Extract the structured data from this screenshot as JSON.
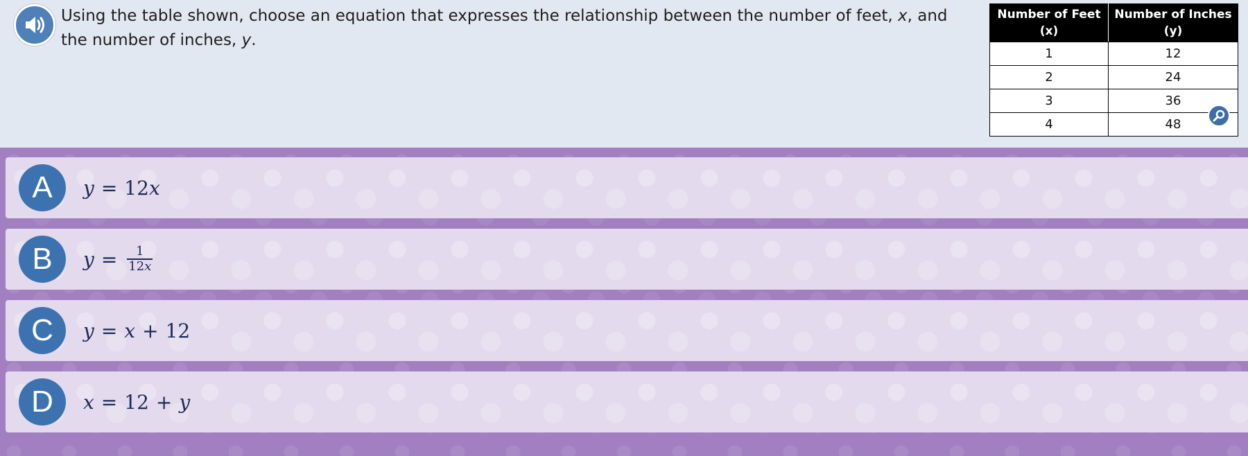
{
  "question": {
    "text_before_x": "Using the table shown, choose an equation that expresses the relationship between the number of feet, ",
    "var_x": "x",
    "text_between": ", and the number of inches, ",
    "var_y": "y",
    "text_end": "."
  },
  "table": {
    "headers": [
      {
        "line1": "Number of Feet",
        "line2": "(x)"
      },
      {
        "line1": "Number of Inches",
        "line2": "(y)"
      }
    ],
    "rows": [
      [
        "1",
        "12"
      ],
      [
        "2",
        "24"
      ],
      [
        "3",
        "36"
      ],
      [
        "4",
        "48"
      ]
    ]
  },
  "icons": {
    "speaker": "speaker-icon",
    "zoom": "magnifier-icon"
  },
  "colors": {
    "accent_blue": "#3d72b0",
    "answers_background": "#a27fc1",
    "choice_background": "#e3daed",
    "question_background": "#e2e8f2"
  },
  "answers": [
    {
      "letter": "A",
      "lhs": "y",
      "op": "=",
      "rhs_num": "12",
      "rhs_var": "x"
    },
    {
      "letter": "B",
      "lhs": "y",
      "op": "=",
      "frac_num": "1",
      "frac_den_num": "12",
      "frac_den_var": "x"
    },
    {
      "letter": "C",
      "lhs": "y",
      "op": "=",
      "rhs_var": "x",
      "plus": "+",
      "rhs_num": "12"
    },
    {
      "letter": "D",
      "lhs": "x",
      "op": "=",
      "rhs_num": "12",
      "plus": "+",
      "rhs_var": "y"
    }
  ]
}
